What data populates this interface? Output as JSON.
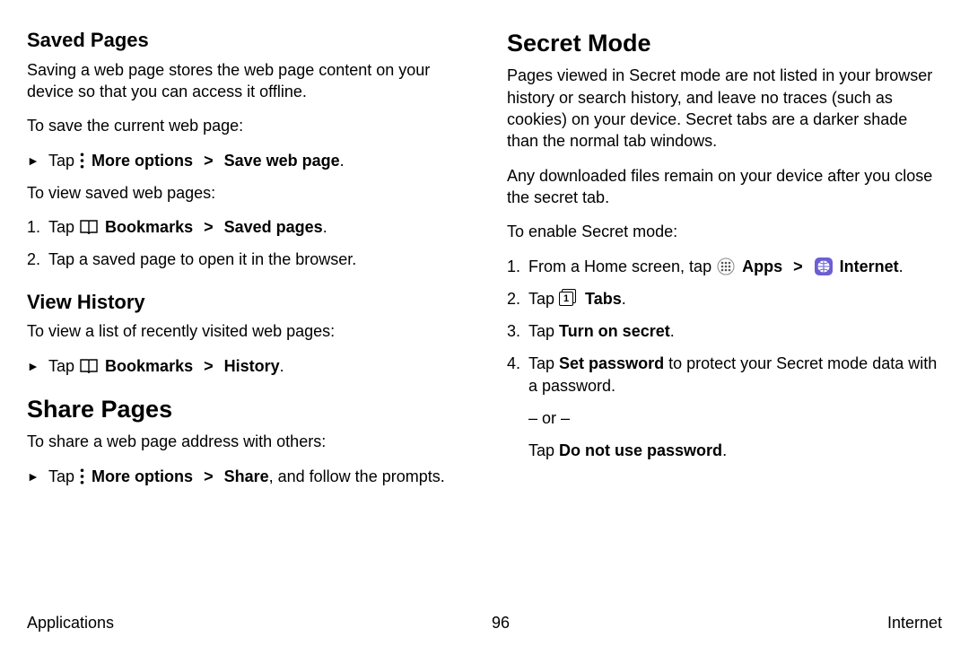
{
  "left": {
    "h_saved": "Saved Pages",
    "saved_desc": "Saving a web page stores the web page content on your device so that you can access it offline.",
    "saved_to_save": "To save the current web page:",
    "save_step": {
      "tap": "Tap ",
      "more": "More options",
      "save": "Save web page"
    },
    "saved_to_view": "To view saved web pages:",
    "view_step1": {
      "tap": "Tap ",
      "bookmarks": "Bookmarks",
      "saved": "Saved pages"
    },
    "view_step2": "Tap a saved page to open it in the browser.",
    "h_history": "View History",
    "history_desc": "To view a list of recently visited web pages:",
    "history_step": {
      "tap": "Tap ",
      "bookmarks": "Bookmarks",
      "history": "History"
    },
    "h_share": "Share Pages",
    "share_desc": "To share a web page address with others:",
    "share_step": {
      "tap": "Tap ",
      "more": "More options",
      "share": "Share",
      "rest": ", and follow the prompts."
    }
  },
  "right": {
    "h_secret": "Secret Mode",
    "secret_desc1": "Pages viewed in Secret mode are not listed in your browser history or search history, and leave no traces (such as cookies) on your device. Secret tabs are a darker shade than the normal tab windows.",
    "secret_desc2": "Any downloaded files remain on your device after you close the secret tab.",
    "secret_enable": "To enable Secret mode:",
    "step1": {
      "a": "From a Home screen, tap ",
      "apps": "Apps",
      "internet": "Internet"
    },
    "step2": {
      "tap": "Tap ",
      "tabs": "Tabs"
    },
    "step3": {
      "tap": "Tap ",
      "turn": "Turn on secret"
    },
    "step4": {
      "tap": "Tap ",
      "setpw": "Set password",
      "rest": " to protect your Secret mode data with a password."
    },
    "or": "– or –",
    "step4b": {
      "tap": "Tap ",
      "nopw": "Do not use password"
    },
    "tabs_num": "1"
  },
  "footer": {
    "left": "Applications",
    "center": "96",
    "right": "Internet"
  }
}
